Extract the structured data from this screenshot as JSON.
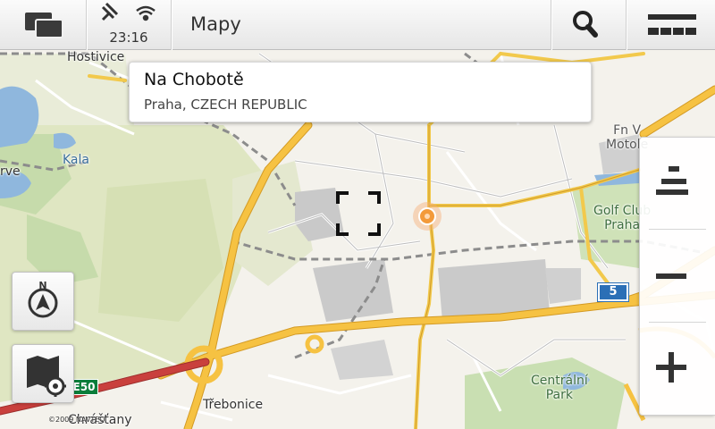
{
  "header": {
    "app_title": "Mapy",
    "clock": "23:16"
  },
  "location_card": {
    "title": "Na Chobotě",
    "subtitle": "Praha, CZECH REPUBLIC"
  },
  "map": {
    "place_labels": {
      "hostivice": "Hostivice",
      "kala": "Kala",
      "rve": "rve",
      "fn_v_motole_1": "Fn V",
      "fn_v_motole_2": "Motole",
      "golf_club_1": "Golf Club",
      "golf_club_2": "Praha",
      "centralni_park_1": "Centrální",
      "centralni_park_2": "Park",
      "trebonice": "Třebonice",
      "chrastany": "Chrášťany"
    },
    "road_shields": {
      "route_5": "5",
      "route_e50": "E50"
    },
    "copyright": "©2009 NAVTEQ"
  },
  "icons": {
    "task_switcher": "task-switcher-icon",
    "signal": "signal-icon",
    "wifi": "wifi-icon",
    "search": "search-icon",
    "menu": "menu-icon",
    "compass": "compass-icon",
    "map_settings": "map-settings-icon",
    "zoom_level": "zoom-level-icon",
    "zoom_out": "zoom-out-icon",
    "zoom_in": "zoom-in-icon"
  },
  "colors": {
    "motorway": "#f2b631",
    "highway": "#c9403d",
    "forest": "#c9dcb0",
    "water": "#8fb7dd",
    "urban": "#f3f1ea",
    "industrial": "#c8c8c8",
    "location": "#f39a3a"
  }
}
